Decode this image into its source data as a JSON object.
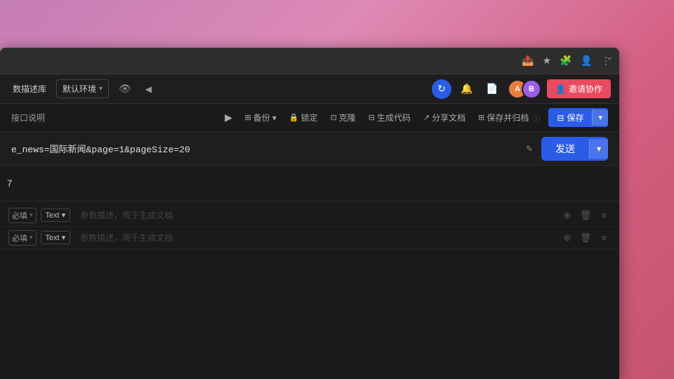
{
  "browser": {
    "collapse_icon": "⌄",
    "icons": [
      "📤",
      "★",
      "🧩",
      "👤",
      "⋮"
    ]
  },
  "app_toolbar": {
    "db_label": "数描述库",
    "env_label": "默认环境",
    "env_chevron": "▾",
    "eye_icon": "👁",
    "back_icon": "◀",
    "sync_icon": "↻",
    "bell_icon": "🔔",
    "doc_icon": "📄",
    "avatar1_initial": "A",
    "avatar2_initial": "B",
    "invite_label": "邀请协作"
  },
  "api_toolbar": {
    "interface_label": "接口说明",
    "play_icon": "▶",
    "backup_label": "备份",
    "backup_chevron": "▾",
    "lock_label": "锁定",
    "clone_label": "克隆",
    "generate_label": "生成代码",
    "share_label": "分享文档",
    "save_archive_label": "保存并归档",
    "save_label": "保存",
    "save_dropdown_icon": "▾"
  },
  "url_bar": {
    "url_text": "e_news=国际新闻&page=1&pageSize=20",
    "send_label": "发送",
    "send_dropdown_icon": "▾"
  },
  "cursor": {
    "line_char": "7"
  },
  "params": [
    {
      "required_label": "必填",
      "type_label": "Text",
      "placeholder": "参数描述，用于生成文档"
    },
    {
      "required_label": "必填",
      "type_label": "Text",
      "placeholder": "参数描述，用于生成文档"
    }
  ]
}
